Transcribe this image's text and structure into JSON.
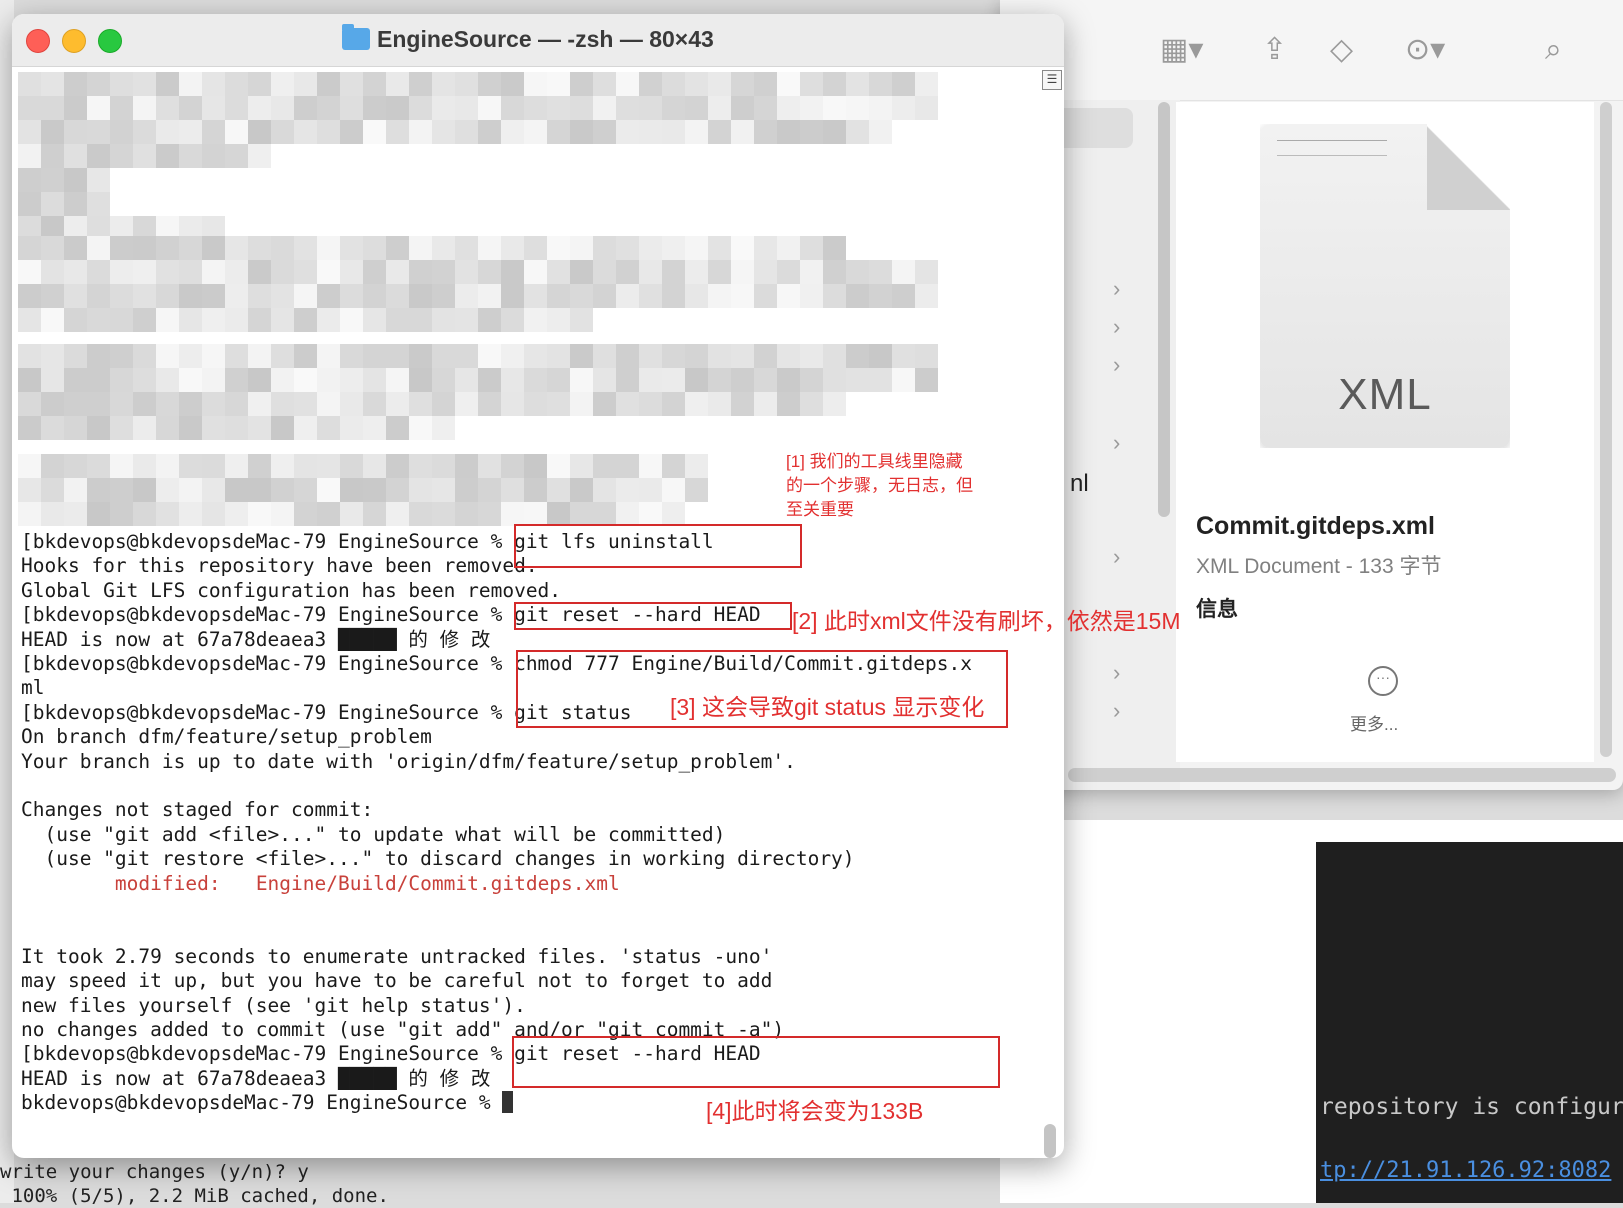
{
  "terminal": {
    "title": "EngineSource — -zsh — 80×43",
    "lines": [
      "[bkdevops@bkdevopsdeMac-79 EngineSource % git lfs uninstall",
      "Hooks for this repository have been removed.",
      "Global Git LFS configuration has been removed.",
      "[bkdevops@bkdevopsdeMac-79 EngineSource % git reset --hard HEAD",
      "HEAD is now at 67a78deaea3 █████ 的 修 改",
      "[bkdevops@bkdevopsdeMac-79 EngineSource % chmod 777 Engine/Build/Commit.gitdeps.x",
      "ml",
      "[bkdevops@bkdevopsdeMac-79 EngineSource % git status",
      "On branch dfm/feature/setup_problem",
      "Your branch is up to date with 'origin/dfm/feature/setup_problem'.",
      "",
      "Changes not staged for commit:",
      "  (use \"git add <file>...\" to update what will be committed)",
      "  (use \"git restore <file>...\" to discard changes in working directory)",
      "",
      "",
      "",
      "It took 2.79 seconds to enumerate untracked files. 'status -uno'",
      "may speed it up, but you have to be careful not to forget to add",
      "new files yourself (see 'git help status').",
      "no changes added to commit (use \"git add\" and/or \"git commit -a\")",
      "[bkdevops@bkdevopsdeMac-79 EngineSource % git reset --hard HEAD",
      "HEAD is now at 67a78deaea3 █████ 的 修 改",
      "bkdevops@bkdevopsdeMac-79 EngineSource % "
    ],
    "modified_label": "modified:",
    "modified_file": "Engine/Build/Commit.gitdeps.xml"
  },
  "annotations": {
    "a1_line1": "[1] 我们的工具线里隐藏",
    "a1_line2": "的一个步骤，无日志，但",
    "a1_line3": "至关重要",
    "a2": "[2] 此时xml文件没有刷坏，依然是15M",
    "a3": "[3] 这会导致git status 显示变化",
    "a4": "[4]此时将会变为133B",
    "color": "#e23030"
  },
  "finder": {
    "file_type_badge": "XML",
    "file_name": "Commit.gitdeps.xml",
    "file_kind": "XML Document - 133 字节",
    "info_header": "信息",
    "more_label": "更多...",
    "stray": "nl",
    "icons": [
      "view-grid-icon",
      "share-icon",
      "tag-icon",
      "more-icon",
      "search-icon"
    ]
  },
  "background": {
    "dark_line1": "repository is configured",
    "dark_line2": "tp://21.91.126.92:8082",
    "behind_line1": "write your changes (y/n)? y",
    "behind_line2": " 100% (5/5), 2.2 MiB cached, done."
  }
}
